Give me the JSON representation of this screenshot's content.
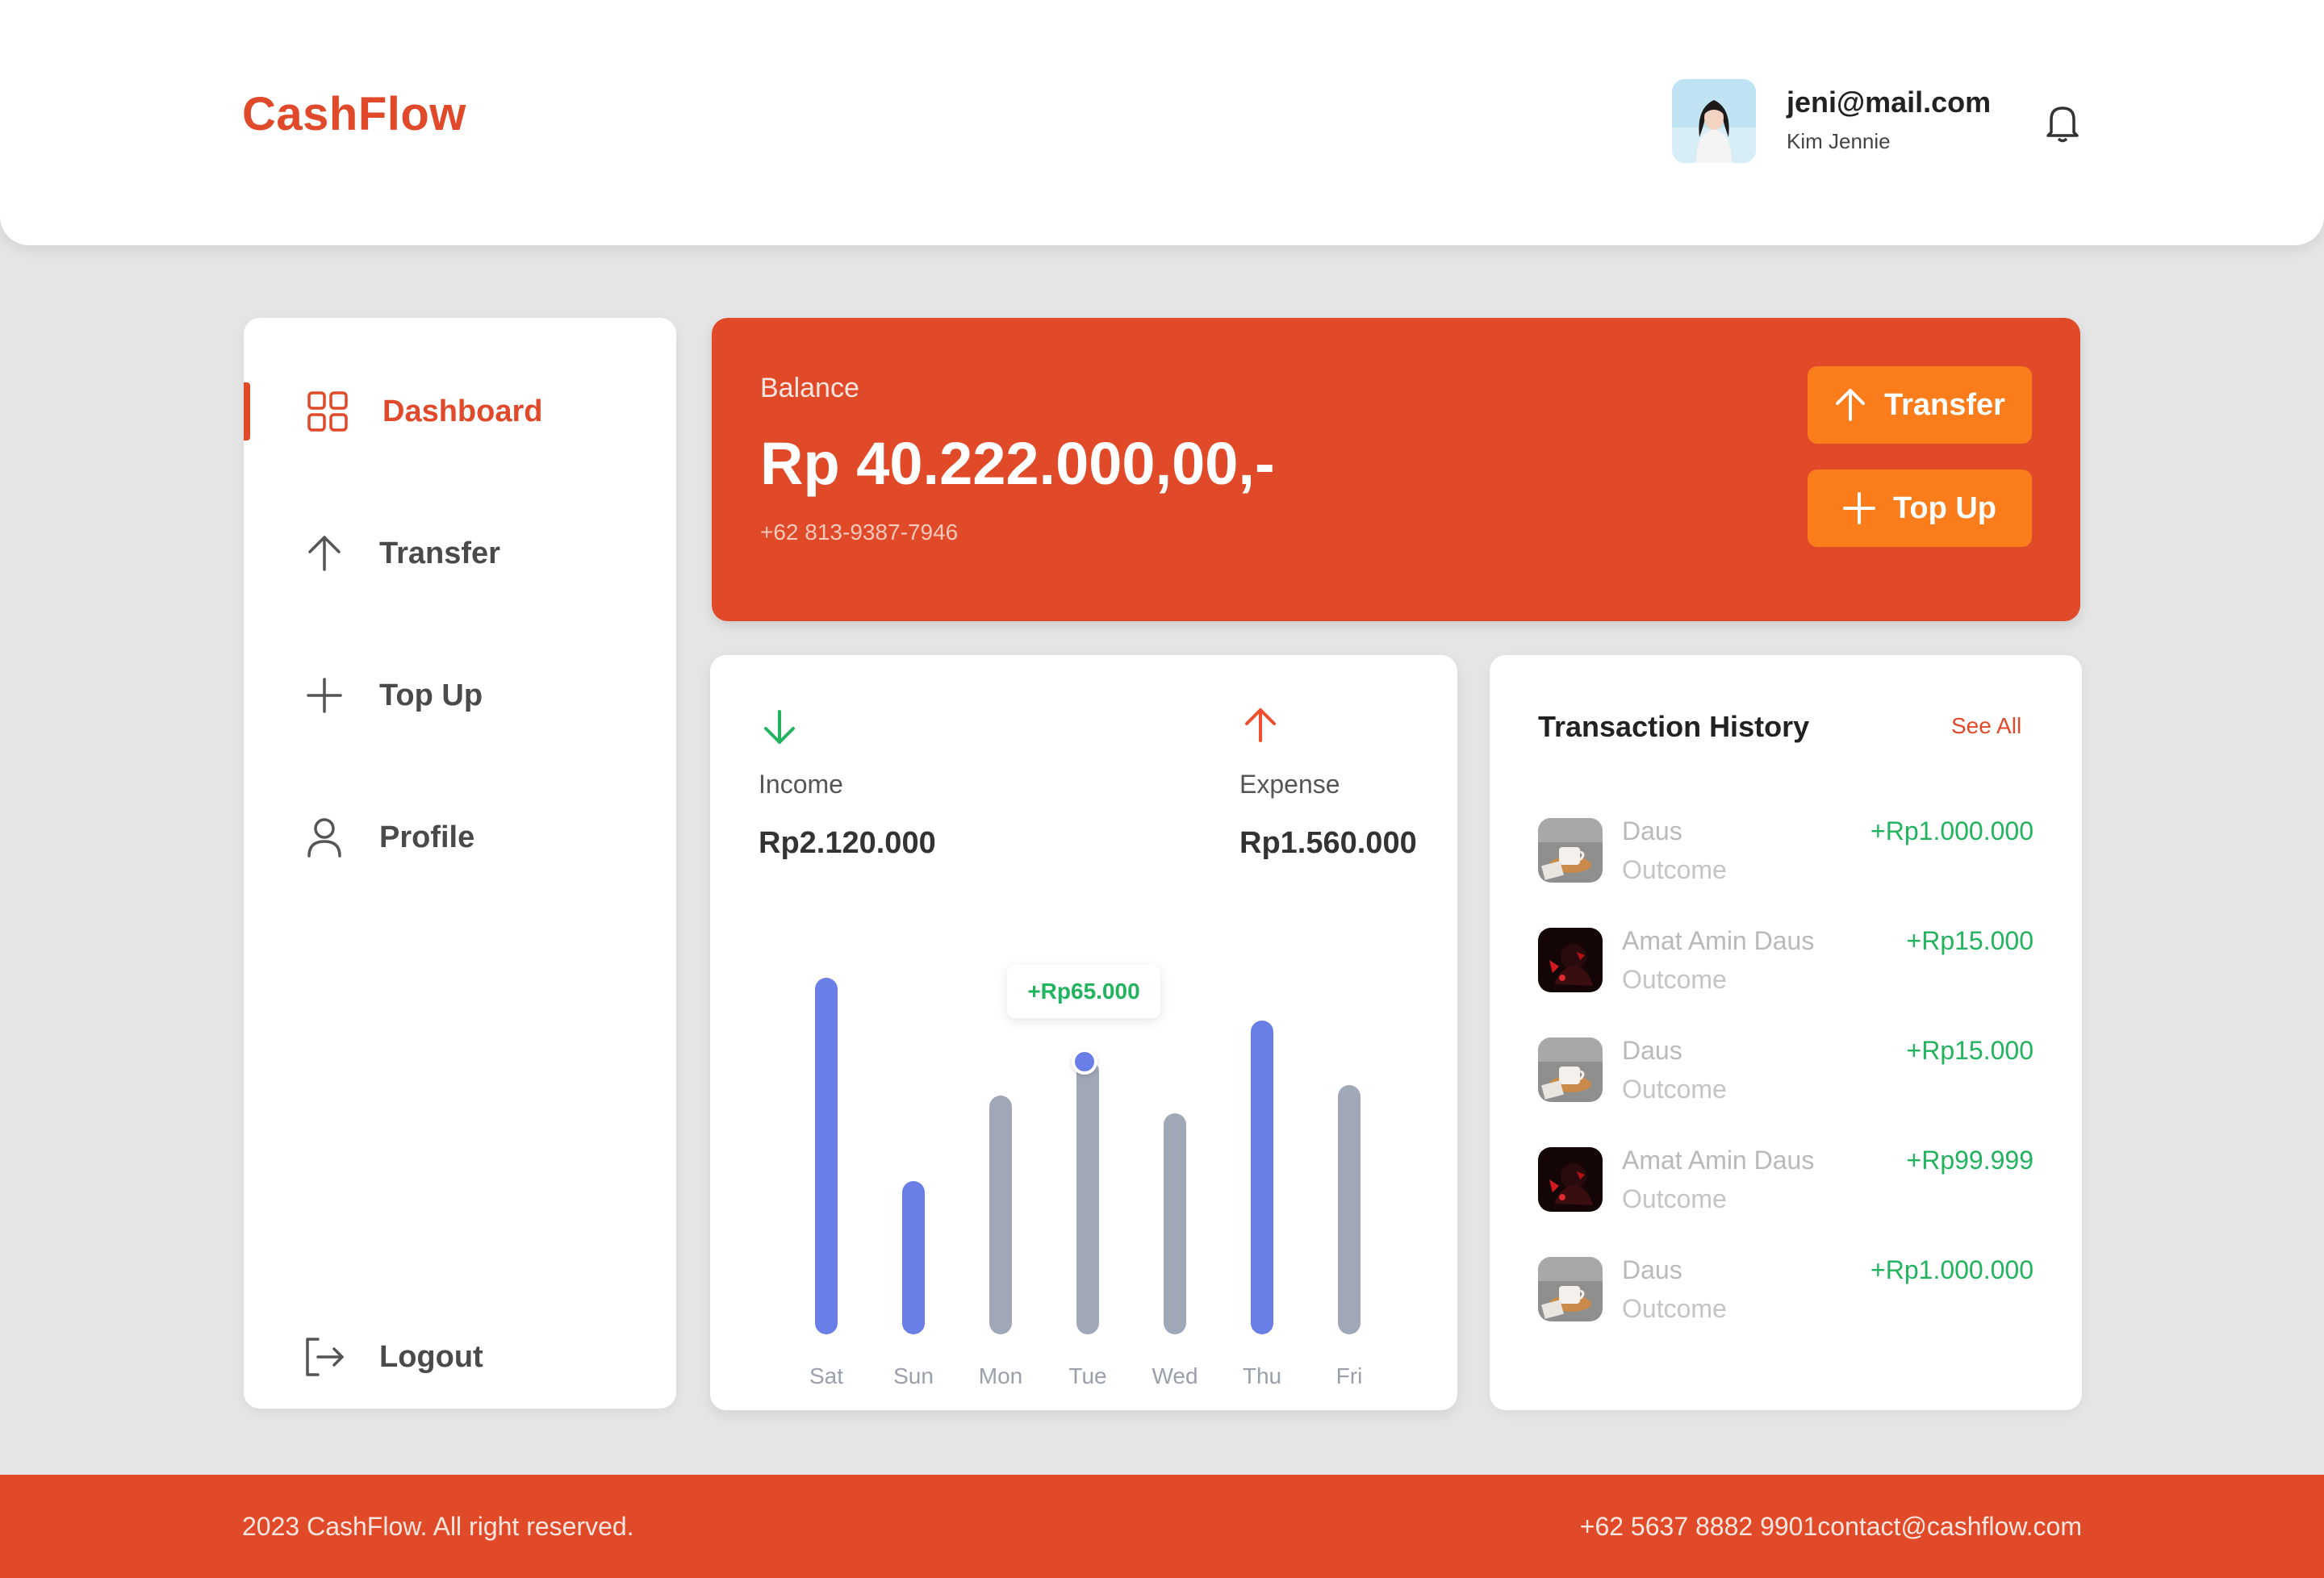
{
  "app": {
    "name": "CashFlow"
  },
  "header": {
    "email": "jeni@mail.com",
    "user_name": "Kim Jennie"
  },
  "sidebar": {
    "items": [
      {
        "label": "Dashboard",
        "icon": "grid-icon",
        "active": true
      },
      {
        "label": "Transfer",
        "icon": "arrow-up-icon",
        "active": false
      },
      {
        "label": "Top Up",
        "icon": "plus-icon",
        "active": false
      },
      {
        "label": "Profile",
        "icon": "user-icon",
        "active": false
      }
    ],
    "logout_label": "Logout"
  },
  "balance": {
    "label": "Balance",
    "amount": "Rp 40.222.000,00,-",
    "phone": "+62 813-9387-7946",
    "transfer_label": "Transfer",
    "topup_label": "Top Up"
  },
  "summary": {
    "income_label": "Income",
    "income_value": "Rp2.120.000",
    "expense_label": "Expense",
    "expense_value": "Rp1.560.000"
  },
  "chart_data": {
    "type": "bar",
    "categories": [
      "Sat",
      "Sun",
      "Mon",
      "Tue",
      "Wed",
      "Thu",
      "Fri"
    ],
    "values": [
      100,
      43,
      67,
      77,
      62,
      88,
      70
    ],
    "highlighted": [
      true,
      true,
      false,
      false,
      false,
      true,
      false
    ],
    "tooltip": {
      "category": "Tue",
      "label": "+Rp65.000"
    },
    "colors": {
      "highlight": "#6a7ee8",
      "normal": "#a0a8b8"
    }
  },
  "history": {
    "title": "Transaction History",
    "see_all": "See All",
    "rows": [
      {
        "name": "Daus",
        "type": "Outcome",
        "amount": "+Rp1.000.000",
        "thumb": "coffee"
      },
      {
        "name": "Amat Amin Daus",
        "type": "Outcome",
        "amount": "+Rp15.000",
        "thumb": "dark"
      },
      {
        "name": "Daus",
        "type": "Outcome",
        "amount": "+Rp15.000",
        "thumb": "coffee"
      },
      {
        "name": "Amat Amin Daus",
        "type": "Outcome",
        "amount": "+Rp99.999",
        "thumb": "dark"
      },
      {
        "name": "Daus",
        "type": "Outcome",
        "amount": "+Rp1.000.000",
        "thumb": "coffee"
      }
    ]
  },
  "footer": {
    "copyright": "2023 CashFlow. All right reserved.",
    "contact": "+62 5637 8882 9901contact@cashflow.com"
  },
  "colors": {
    "brand": "#e0492a",
    "button": "#fb7c1a",
    "income": "#22b35e",
    "expense": "#ef4d2d"
  }
}
